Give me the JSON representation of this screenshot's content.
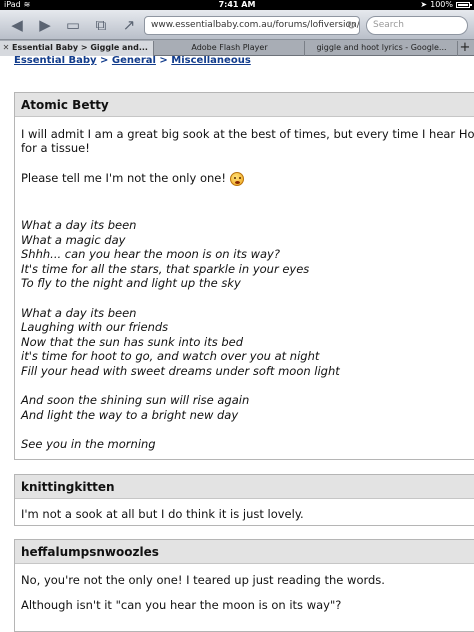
{
  "status_bar": {
    "device": "iPad",
    "time": "7:41 AM",
    "battery": "100%",
    "battery_level": 1.0
  },
  "toolbar": {
    "url": "www.essentialbaby.com.au/forums/lofiversion/i",
    "search_placeholder": "Search"
  },
  "tabs": [
    {
      "label": "Essential Baby > Giggle and...",
      "active": true
    },
    {
      "label": "Adobe Flash Player",
      "active": false
    },
    {
      "label": "giggle and hoot lyrics - Google...",
      "active": false
    }
  ],
  "breadcrumb": {
    "items": [
      "Essential Baby",
      "General",
      "Miscellaneous"
    ],
    "separator": ">"
  },
  "posts": [
    {
      "author": "Atomic Betty",
      "lines": [
        "I will admit I am a great big sook at the best of times, but every time I hear Hoo",
        "for a tissue!",
        "Please tell me I'm not the only one!",
        "What a day its been",
        "What a magic day",
        "Shhh... can you hear the moon is on its way?",
        "It's time for all the stars, that sparkle in your eyes",
        "To fly to the night and light up the sky",
        "What a day its been",
        "Laughing with our friends",
        "Now that the sun has sunk into its bed",
        "it's time for hoot to go, and watch over you at night",
        "Fill your head with sweet dreams under soft moon light",
        "And soon the shining sun will rise again",
        "And light the way to a bright new day",
        "See you in the morning"
      ]
    },
    {
      "author": "knittingkitten",
      "lines": [
        "I'm not a sook at all but I do think it is just lovely."
      ]
    },
    {
      "author": "heffalumpsnwoozles",
      "lines": [
        "No, you're not the only one! I teared up just reading the words.",
        "Although isn't it \"can you hear the moon is on its way\"?"
      ]
    }
  ]
}
